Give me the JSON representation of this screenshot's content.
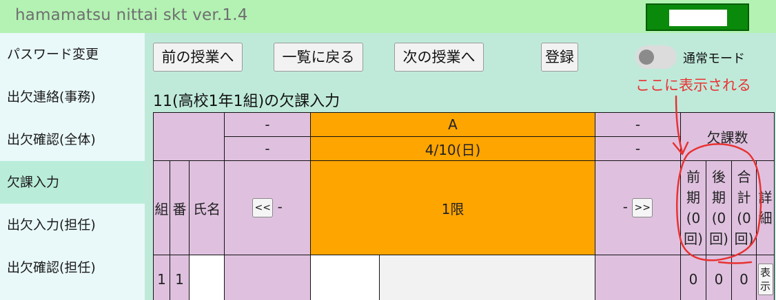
{
  "header": {
    "title": "hamamatsu nittai skt ver.1.4"
  },
  "sidebar": {
    "items": [
      {
        "label": "パスワード変更"
      },
      {
        "label": "出欠連絡(事務)"
      },
      {
        "label": "出欠確認(全体)"
      },
      {
        "label": "欠課入力"
      },
      {
        "label": "出欠入力(担任)"
      },
      {
        "label": "出欠確認(担任)"
      }
    ],
    "active_index": 3
  },
  "toolbar": {
    "prev_label": "前の授業へ",
    "list_label": "一覧に戻る",
    "next_label": "次の授業へ",
    "register_label": "登録",
    "mode_label": "通常モード"
  },
  "annotation": {
    "text": "ここに表示される"
  },
  "section": {
    "title": "11(高校1年1組)の欠課入力"
  },
  "table": {
    "row1": {
      "left": "-",
      "center": "A",
      "right": "-"
    },
    "row2": {
      "left": "-",
      "center": "4/10(日)",
      "right": "-"
    },
    "absences_header": "欠課数",
    "col_kumi": "組",
    "col_ban": "番",
    "col_name": "氏名",
    "prev_nav": "<<",
    "next_nav": ">>",
    "left_dash": "-",
    "right_dash": "-",
    "period": "1限",
    "first_half": [
      "前",
      "期",
      "(0",
      "回)"
    ],
    "second_half": [
      "後",
      "期",
      "(0",
      "回)"
    ],
    "total": [
      "合",
      "計",
      "(0",
      "回)"
    ],
    "detail": [
      "詳",
      "細"
    ],
    "student_row": {
      "kumi": "1",
      "ban": "1",
      "first_half": "0",
      "second_half": "0",
      "total": "0",
      "detail_btn": [
        "表",
        "示"
      ]
    }
  },
  "colors": {
    "header_bg": "#b3f2b3",
    "main_bg": "#bfeada",
    "table_cell": "#dfc1df",
    "highlight": "#ffa500",
    "annotation": "#e83232",
    "header_button": "#0a8a0a"
  }
}
